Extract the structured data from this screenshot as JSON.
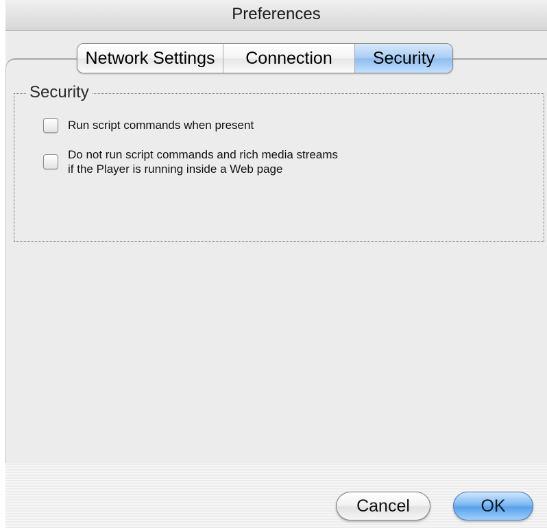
{
  "window": {
    "title": "Preferences"
  },
  "tabs": [
    {
      "label": "Network Settings",
      "selected": false
    },
    {
      "label": "Connection",
      "selected": false
    },
    {
      "label": "Security",
      "selected": true
    }
  ],
  "security_group": {
    "title": "Security",
    "options": [
      {
        "label": "Run script commands when present",
        "checked": false
      },
      {
        "label_line1": "Do not run script commands and rich media streams",
        "label_line2": "if the Player is running inside a Web page",
        "checked": false
      }
    ]
  },
  "buttons": {
    "cancel_label": "Cancel",
    "ok_label": "OK"
  },
  "colors": {
    "selected_tab": "#a9cdf4",
    "default_button": "#5aa0ea"
  }
}
